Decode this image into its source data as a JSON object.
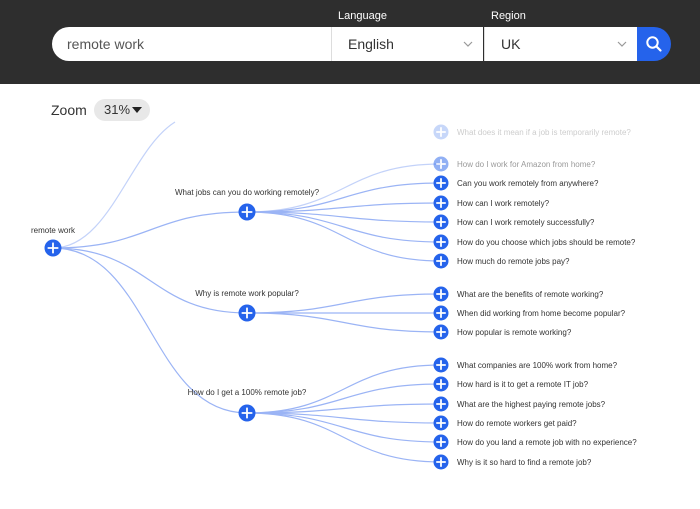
{
  "header": {
    "language_label": "Language",
    "region_label": "Region",
    "search_value": "remote work",
    "language_value": "English",
    "region_value": "UK"
  },
  "zoom": {
    "label": "Zoom",
    "value": "31%"
  },
  "colors": {
    "accent": "#2563eb",
    "header_bg": "#2e2e2e",
    "link_line": "#9bb4f5"
  },
  "tree": {
    "root": "remote work",
    "faded_question": "What does it mean if a job is temporarily remote?",
    "branches": [
      {
        "question": "What jobs can you do working remotely?",
        "children": [
          "How do I work for Amazon from home?",
          "Can you work remotely from anywhere?",
          "How can I work remotely?",
          "How can I work remotely successfully?",
          "How do you choose which jobs should be remote?",
          "How much do remote jobs pay?"
        ]
      },
      {
        "question": "Why is remote work popular?",
        "children": [
          "What are the benefits of remote working?",
          "When did working from home become popular?",
          "How popular is remote working?"
        ]
      },
      {
        "question": "How do I get a 100% remote job?",
        "children": [
          "What companies are 100% work from home?",
          "How hard is it to get a remote IT job?",
          "What are the highest paying remote jobs?",
          "How do remote workers get paid?",
          "How do you land a remote job with no experience?",
          "Why is it so hard to find a remote job?"
        ]
      }
    ]
  }
}
